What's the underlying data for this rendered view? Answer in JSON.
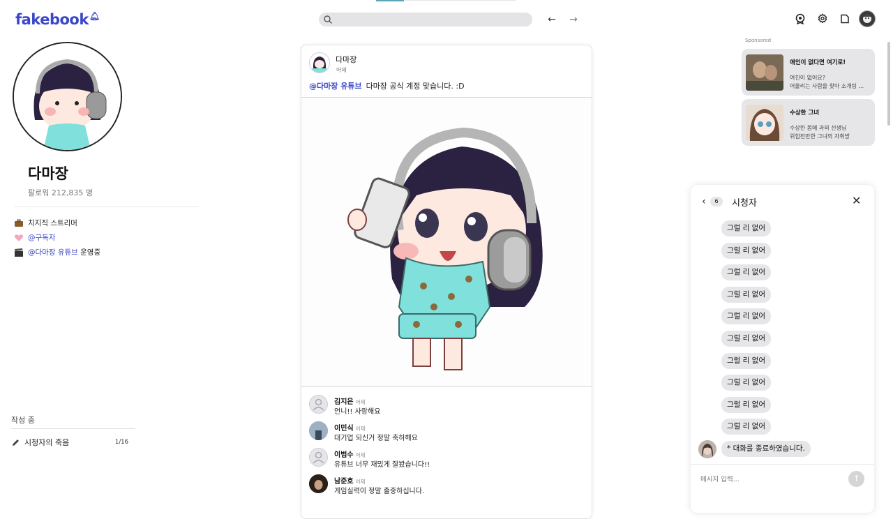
{
  "app": {
    "logo": "fakebook",
    "search_placeholder": ""
  },
  "nav": {
    "back": "←",
    "forward": "→"
  },
  "topbar_icons": [
    "badge-icon",
    "settings-gear-icon",
    "note-icon",
    "user-avatar"
  ],
  "profile": {
    "name": "다마장",
    "followers": "팔로워 212,835 명",
    "bio": [
      {
        "icon": "briefcase-icon",
        "text": "치지직 스트리머",
        "mention": ""
      },
      {
        "icon": "pink-heart-icon",
        "text": "",
        "mention": "@구독자"
      },
      {
        "icon": "clapper-icon",
        "mention": "@다마장 유튜브",
        "text": " 운영중"
      }
    ],
    "drafts": {
      "label": "작성 중",
      "items": [
        {
          "title": "시청자의 죽음",
          "count": "1/16"
        }
      ]
    }
  },
  "post": {
    "author": "다마장",
    "time": "어제",
    "mention": "@다마장 유튜브",
    "text": "다마장 공식 계정 맞습니다. :D",
    "comments": [
      {
        "name": "김지은",
        "time": "어제",
        "text": "언니!! 사랑해요"
      },
      {
        "name": "이민식",
        "time": "어제",
        "text": "대기업 되신거 정말 축하해요"
      },
      {
        "name": "이범수",
        "time": "어제",
        "text": "유튜브 너무 재밌게 잘봤습니다!!"
      },
      {
        "name": "남준호",
        "time": "어제",
        "text": "게임실력이 정말 출중하십니다."
      }
    ]
  },
  "sponsored": {
    "label": "Sponsored",
    "ads": [
      {
        "title": "애인이 없다면 여기로!",
        "line1": "여친이 없어요?",
        "line2": "어울리는 사람을 찾아 소개팅 ..."
      },
      {
        "title": "수상한 그녀",
        "line1": "수상한 몸매 과외 선생님",
        "line2": "위험천만한 그녀의 자취방"
      }
    ]
  },
  "chat": {
    "count": "6",
    "title": "시청자",
    "messages": [
      "그럴 리 없어",
      "그럴 리 없어",
      "그럴 리 없어",
      "그럴 리 없어",
      "그럴 리 없어",
      "그럴 리 없어",
      "그럴 리 없어",
      "그럴 리 없어",
      "그럴 리 없어",
      "그럴 리 없어"
    ],
    "system_message": "* 대화를 종료하였습니다.",
    "input_placeholder": "메시지 입력..."
  }
}
